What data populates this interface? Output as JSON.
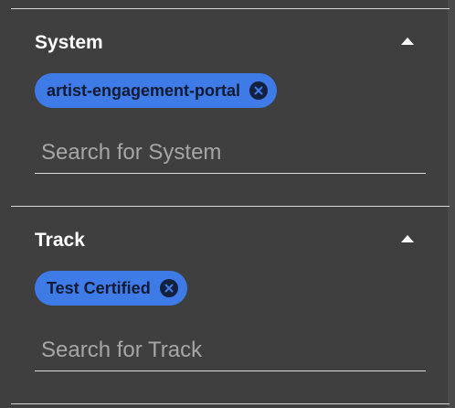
{
  "filters": [
    {
      "title": "System",
      "toggle_icon": "caret-up-icon",
      "chips": [
        {
          "label": "artist-engagement-portal",
          "remove_icon": "close-circle-icon"
        }
      ],
      "search": {
        "placeholder": "Search for System",
        "value": ""
      }
    },
    {
      "title": "Track",
      "toggle_icon": "caret-up-icon",
      "chips": [
        {
          "label": "Test Certified",
          "remove_icon": "close-circle-icon"
        }
      ],
      "search": {
        "placeholder": "Search for Track",
        "value": ""
      }
    }
  ],
  "colors": {
    "background": "#3f3f3f",
    "chip": "#3f7be7",
    "chip_text": "#121b32",
    "divider": "#d7d7d7"
  }
}
